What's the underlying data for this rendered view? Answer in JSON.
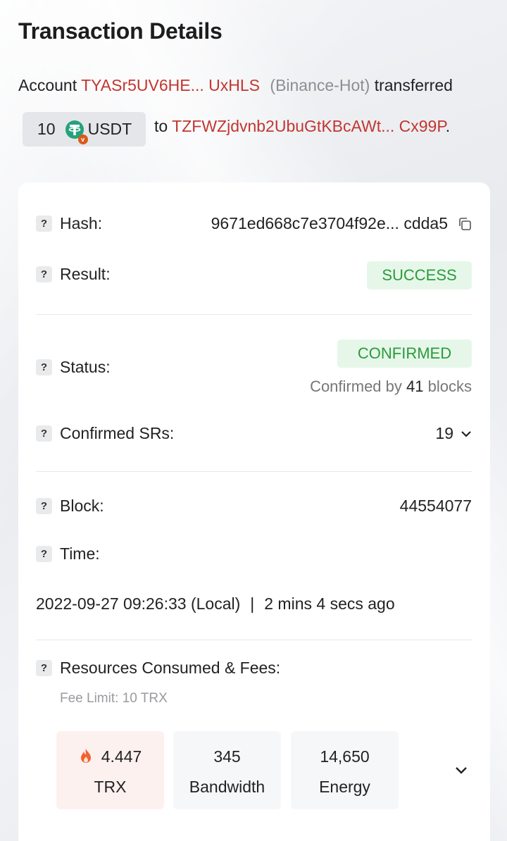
{
  "page_title": "Transaction Details",
  "summary": {
    "account_prefix": "Account",
    "from_address": "TYASr5UV6HE... UxHLS",
    "from_tag": "(Binance-Hot)",
    "verb": "transferred",
    "amount": "10",
    "token": "USDT",
    "to_prefix": "to",
    "to_address": "TZFWZjdvnb2UbuGtKBcAWt... Cx99P",
    "end_punct": ".",
    "token_badge": "v"
  },
  "details": {
    "hash_label": "Hash:",
    "hash_value": "9671ed668c7e3704f92e... cdda5",
    "result_label": "Result:",
    "result_value": "SUCCESS",
    "status_label": "Status:",
    "status_value": "CONFIRMED",
    "confirmed_by_prefix": "Confirmed by",
    "confirmed_by_count": "41",
    "confirmed_by_suffix": "blocks",
    "srs_label": "Confirmed SRs:",
    "srs_value": "19",
    "block_label": "Block:",
    "block_value": "44554077",
    "time_label": "Time:",
    "time_local": "2022-09-27 09:26:33 (Local)",
    "time_sep": "|",
    "time_ago": "2 mins 4 secs ago",
    "resources_label": "Resources Consumed & Fees:",
    "fee_limit": "Fee Limit: 10 TRX",
    "help_glyph": "?"
  },
  "resources": {
    "trx_value": "4.447",
    "trx_unit": "TRX",
    "bandwidth_value": "345",
    "bandwidth_unit": "Bandwidth",
    "energy_value": "14,650",
    "energy_unit": "Energy"
  },
  "colors": {
    "address": "#c23631",
    "success": "#2b9b3a",
    "success_bg": "#e6f7ea",
    "usdt": "#26a17b"
  },
  "icons": [
    "usdt-logo-icon",
    "copy-icon",
    "chevron-down-icon",
    "fire-icon",
    "help-icon"
  ]
}
